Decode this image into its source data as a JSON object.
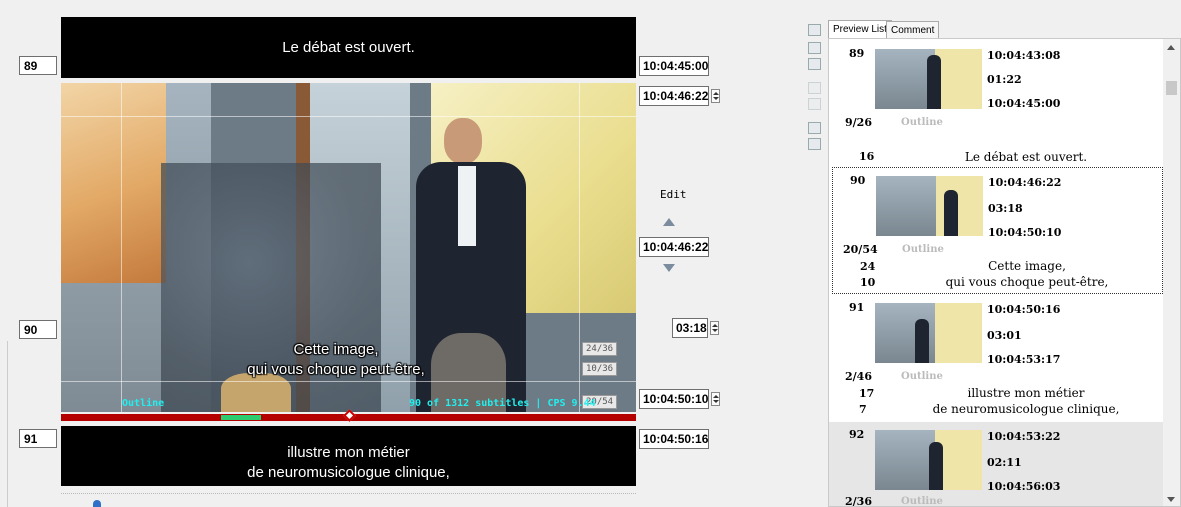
{
  "editor": {
    "prev": {
      "number": "89",
      "text": "Le débat est ouvert.",
      "end_tc": "10:04:45:00"
    },
    "current": {
      "number": "90",
      "start_tc": "10:04:46:22",
      "edit_label": "Edit",
      "edit_tc": "10:04:46:22",
      "duration": "03:18",
      "end_tc": "10:04:50:10",
      "line1": "Cette image,",
      "line2": "qui vous choque peut-être,",
      "count_line1": "24/36",
      "count_line2": "10/36",
      "count_total": "20/54"
    },
    "next": {
      "number": "91",
      "start_tc": "10:04:50:16",
      "line1": "illustre mon métier",
      "line2": "de neuromusicologue clinique,"
    },
    "video_overlay": {
      "outline_label": "Outline",
      "status": "90 of 1312 subtitles | CPS 9.44"
    }
  },
  "panel": {
    "tabs": [
      "Preview List",
      "Comment"
    ],
    "entries": [
      {
        "num": "89",
        "tc_in": "10:04:43:08",
        "dur": "01:22",
        "tc_out": "10:04:45:00",
        "ratio": "9/26",
        "outline": "Outline",
        "c1": "16",
        "c2": "",
        "line1": "Le débat est ouvert.",
        "line2": ""
      },
      {
        "num": "90",
        "tc_in": "10:04:46:22",
        "dur": "03:18",
        "tc_out": "10:04:50:10",
        "ratio": "20/54",
        "outline": "Outline",
        "c1": "24",
        "c2": "10",
        "line1": "Cette image,",
        "line2": "qui vous choque peut-être,"
      },
      {
        "num": "91",
        "tc_in": "10:04:50:16",
        "dur": "03:01",
        "tc_out": "10:04:53:17",
        "ratio": "2/46",
        "outline": "Outline",
        "c1": "17",
        "c2": "7",
        "line1": "illustre mon métier",
        "line2": "de neuromusicologue clinique,"
      },
      {
        "num": "92",
        "tc_in": "10:04:53:22",
        "dur": "02:11",
        "tc_out": "10:04:56:03",
        "ratio": "2/36",
        "outline": "Outline",
        "c1": "",
        "c2": "",
        "line1": "",
        "line2": ""
      }
    ]
  },
  "colors": {
    "timeline": "#b00000",
    "marker": "#2ecc71",
    "cyan": "#22eeee",
    "selection_border": "#333333"
  },
  "icons": [
    "align-top-icon",
    "align-list-icon",
    "align-bottom-icon",
    "move-up-icon",
    "move-down-icon",
    "insert-above-icon",
    "insert-below-icon",
    "up-arrow-icon",
    "down-arrow-icon"
  ]
}
